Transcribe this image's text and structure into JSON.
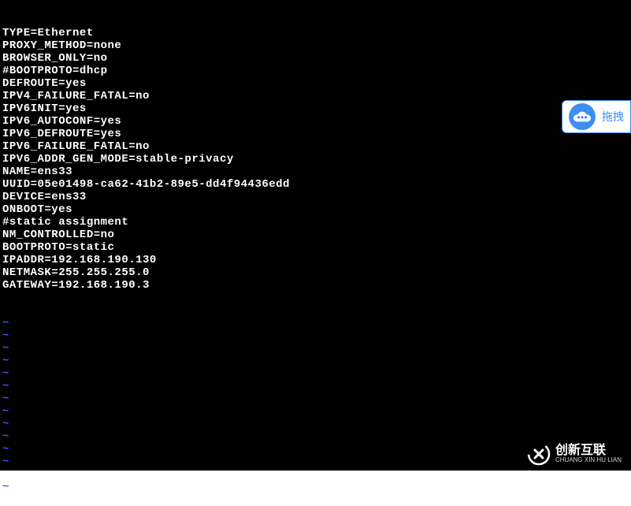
{
  "terminal": {
    "lines": [
      "TYPE=Ethernet",
      "PROXY_METHOD=none",
      "BROWSER_ONLY=no",
      "#BOOTPROTO=dhcp",
      "DEFROUTE=yes",
      "IPV4_FAILURE_FATAL=no",
      "IPV6INIT=yes",
      "IPV6_AUTOCONF=yes",
      "IPV6_DEFROUTE=yes",
      "IPV6_FAILURE_FATAL=no",
      "IPV6_ADDR_GEN_MODE=stable-privacy",
      "NAME=ens33",
      "UUID=05e01498-ca62-41b2-89e5-dd4f94436edd",
      "DEVICE=ens33",
      "ONBOOT=yes",
      "",
      "#static assignment",
      "NM_CONTROLLED=no",
      "BOOTPROTO=static",
      "IPADDR=192.168.190.130",
      "NETMASK=255.255.255.0",
      "GATEWAY=192.168.190.3"
    ],
    "filler": "~",
    "filler_count": 14
  },
  "floating": {
    "label": "拖拽"
  },
  "watermark": {
    "zh": "创新互联",
    "en": "CHUANG XIN HU LIAN"
  }
}
